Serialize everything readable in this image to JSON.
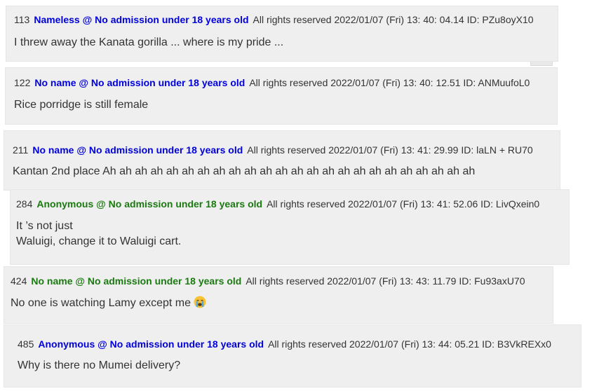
{
  "posts": [
    {
      "num": "113",
      "name": "Nameless @ No admission under 18 years old",
      "meta": "All rights reserved 2022/01/07 (Fri) 13: 40: 04.14  ID: PZu8oyX10",
      "lines": [
        "I threw away the Kanata gorilla ... where is my pride ..."
      ]
    },
    {
      "num": "122",
      "name": "No name @ No admission under 18 years old",
      "meta": "All rights reserved 2022/01/07 (Fri) 13: 40: 12.51  ID: ANMuufoL0",
      "lines": [
        "Rice porridge is still female"
      ]
    },
    {
      "num": "211",
      "name": "No name @ No admission under 18 years old",
      "meta": "All rights reserved 2022/01/07 (Fri) 13: 41: 29.99  ID: laLN + RU70",
      "lines": [
        "Kantan 2nd place Ah ah ah ah ah ah ah ah ah ah ah ah ah ah ah ah ah ah ah ah ah ah ah ah"
      ]
    },
    {
      "num": "284",
      "name": "Anonymous @ No admission under 18 years old",
      "meta": "All rights reserved 2022/01/07 (Fri) 13: 41: 52.06  ID: LivQxein0",
      "lines": [
        "It ’s not just",
        "Waluigi, change it to Waluigi cart."
      ]
    },
    {
      "num": "424",
      "name": "No name @ No admission under 18 years old",
      "meta": "All rights reserved 2022/01/07 (Fri) 13: 43: 11.79  ID: Fu93axU70",
      "lines": [
        "No one is watching Lamy except me"
      ],
      "emoji": "crying-face"
    },
    {
      "num": "485",
      "name": "Anonymous @ No admission under 18 years old",
      "meta": "All rights reserved 2022/01/07 (Fri) 13: 44: 05.21  ID: B3VkREXx0",
      "lines": [
        "Why is there no Mumei delivery?"
      ]
    }
  ],
  "colors": {
    "name_blue": "#0000dd",
    "name_green": "#1a7a10",
    "post_bg": "#efefef"
  }
}
